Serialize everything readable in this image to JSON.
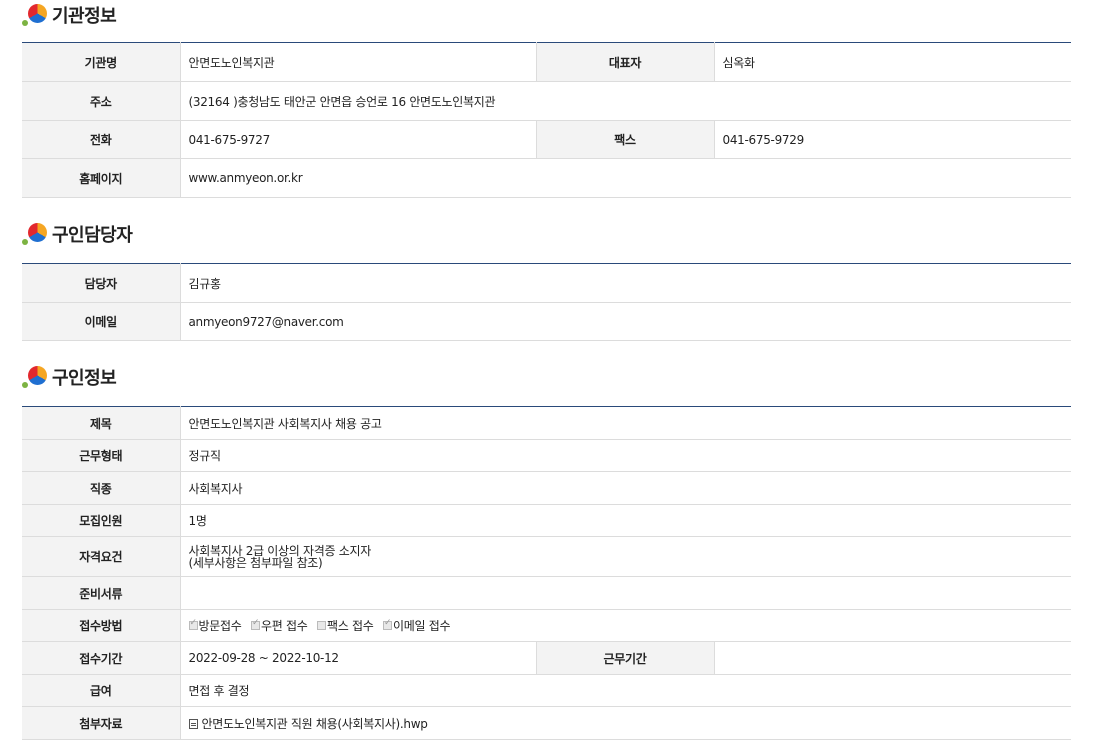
{
  "org_section": {
    "title": "기관정보",
    "rows": {
      "name_label": "기관명",
      "name_value": "안면도노인복지관",
      "rep_label": "대표자",
      "rep_value": "심옥화",
      "addr_label": "주소",
      "addr_value": "(32164 )충청남도 태안군 안면읍 승언로 16 안면도노인복지관",
      "phone_label": "전화",
      "phone_value": "041-675-9727",
      "fax_label": "팩스",
      "fax_value": "041-675-9729",
      "home_label": "홈페이지",
      "home_value": "www.anmyeon.or.kr"
    }
  },
  "contact_section": {
    "title": "구인담당자",
    "rows": {
      "manager_label": "담당자",
      "manager_value": "김규홍",
      "email_label": "이메일",
      "email_value": "anmyeon9727@naver.com"
    }
  },
  "job_section": {
    "title": "구인정보",
    "rows": {
      "subject_label": "제목",
      "subject_value": "안면도노인복지관 사회복지사 채용 공고",
      "worktype_label": "근무형태",
      "worktype_value": "정규직",
      "jobtype_label": "직종",
      "jobtype_value": "사회복지사",
      "headcount_label": "모집인원",
      "headcount_value": "1명",
      "qual_label": "자격요건",
      "qual_line1": "사회복지사 2급 이상의 자격증 소지자",
      "qual_line2": "(세부사항은 첨부파일 참조)",
      "docs_label": "준비서류",
      "docs_value": "",
      "method_label": "접수방법",
      "methods": [
        {
          "label": "방문접수",
          "checked": true
        },
        {
          "label": "우편 접수",
          "checked": true
        },
        {
          "label": "팩스 접수",
          "checked": false
        },
        {
          "label": "이메일 접수",
          "checked": true
        }
      ],
      "period_label": "접수기간",
      "period_value": "2022-09-28 ~ 2022-10-12",
      "workperiod_label": "근무기간",
      "workperiod_value": "",
      "salary_label": "급여",
      "salary_value": "면접 후 결정",
      "attach_label": "첨부자료",
      "attach_value": "안면도노인복지관 직원 채용(사회복지사).hwp"
    }
  }
}
